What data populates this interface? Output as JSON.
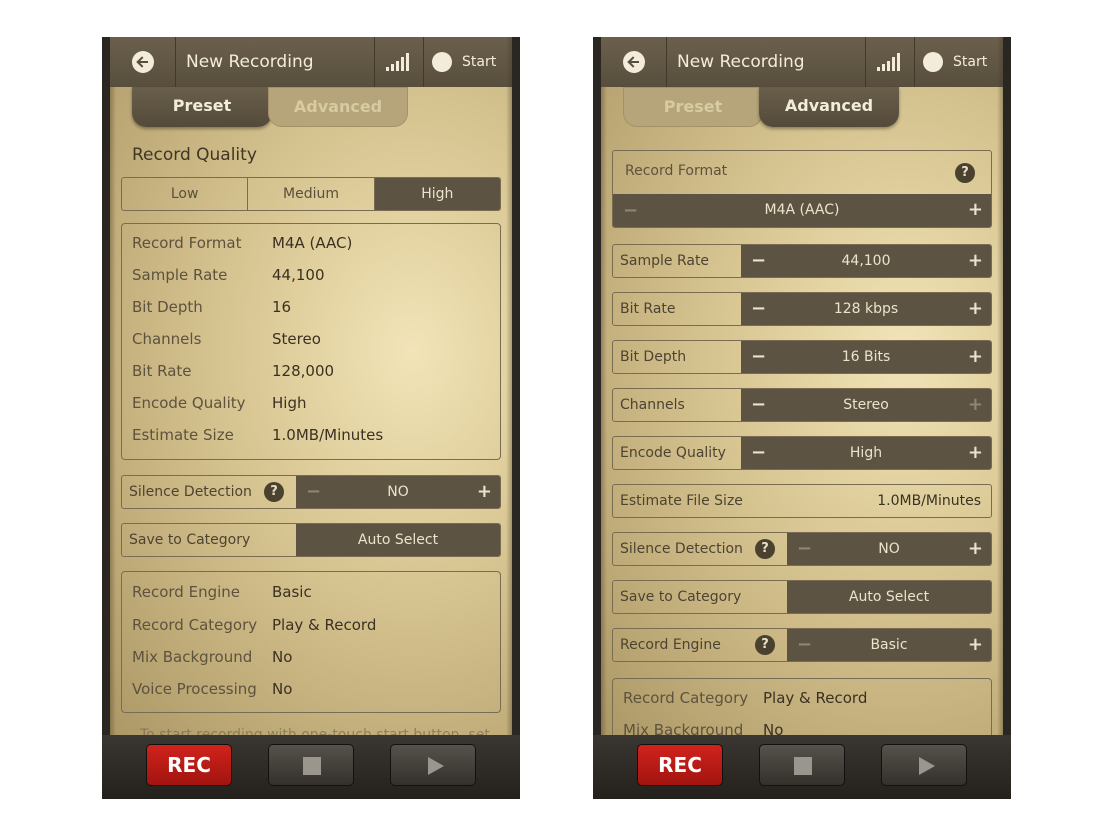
{
  "header": {
    "title": "New Recording",
    "start_label": "Start"
  },
  "tabs": {
    "preset": "Preset",
    "advanced": "Advanced"
  },
  "preset": {
    "section_title": "Record Quality",
    "quality_options": [
      "Low",
      "Medium",
      "High"
    ],
    "selected_quality": "High",
    "info": [
      {
        "key": "Record Format",
        "value": "M4A (AAC)"
      },
      {
        "key": "Sample Rate",
        "value": "44,100"
      },
      {
        "key": "Bit Depth",
        "value": "16"
      },
      {
        "key": "Channels",
        "value": "Stereo"
      },
      {
        "key": "Bit Rate",
        "value": "128,000"
      },
      {
        "key": "Encode Quality",
        "value": "High"
      },
      {
        "key": "Estimate Size",
        "value": "1.0MB/Minutes"
      }
    ],
    "silence_label": "Silence Detection",
    "silence_value": "NO",
    "category_label": "Save to Category",
    "category_value": "Auto Select",
    "engine_info": [
      {
        "key": "Record Engine",
        "value": "Basic"
      },
      {
        "key": "Record Category",
        "value": "Play & Record"
      },
      {
        "key": "Mix Background",
        "value": "No"
      },
      {
        "key": "Voice Processing",
        "value": "No"
      }
    ],
    "footer_faded": "To start recording with one-touch start button, set..."
  },
  "advanced": {
    "format_label": "Record Format",
    "format_value": "M4A (AAC)",
    "controls": [
      {
        "label": "Sample Rate",
        "value": "44,100"
      },
      {
        "label": "Bit Rate",
        "value": "128 kbps"
      },
      {
        "label": "Bit Depth",
        "value": "16 Bits"
      },
      {
        "label": "Channels",
        "value": "Stereo"
      },
      {
        "label": "Encode Quality",
        "value": "High"
      }
    ],
    "estimate_label": "Estimate File Size",
    "estimate_value": "1.0MB/Minutes",
    "silence_label": "Silence Detection",
    "silence_value": "NO",
    "category_label": "Save to Category",
    "category_value": "Auto Select",
    "engine_label": "Record Engine",
    "engine_value": "Basic",
    "engine_info": [
      {
        "key": "Record Category",
        "value": "Play & Record"
      },
      {
        "key": "Mix Background",
        "value": "No"
      }
    ]
  },
  "bottom": {
    "rec_label": "REC"
  },
  "colors": {
    "accent_dark": "#5d5342",
    "rec_red": "#c41e17",
    "parchment": "#dccb98"
  },
  "icons": [
    "back-arrow-icon",
    "signal-bars-icon",
    "record-dot-icon",
    "help-icon",
    "stop-icon",
    "play-icon"
  ]
}
